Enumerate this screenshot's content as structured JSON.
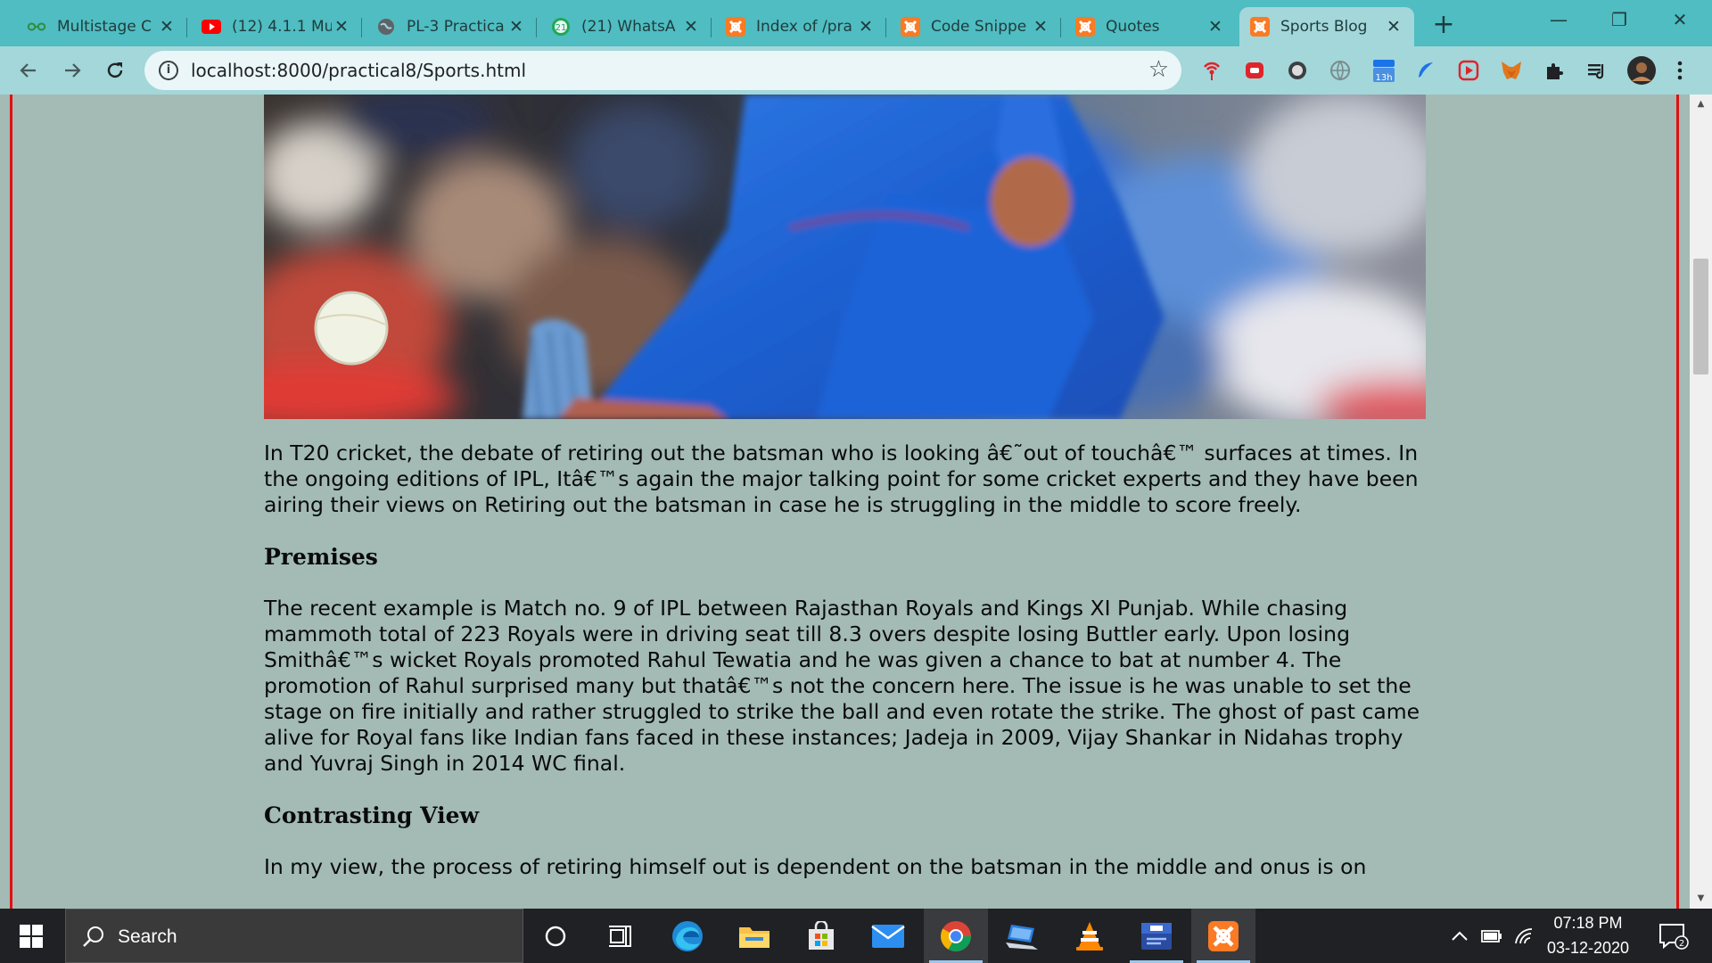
{
  "browser": {
    "tabs": [
      {
        "title": "Multistage C",
        "icon": "gfg-icon"
      },
      {
        "title": "(12) 4.1.1 Mu",
        "icon": "youtube-icon"
      },
      {
        "title": "PL-3 Practica",
        "icon": "globe-icon"
      },
      {
        "title": "(21) WhatsA",
        "icon": "whatsapp-icon"
      },
      {
        "title": "Index of /pra",
        "icon": "xampp-icon"
      },
      {
        "title": "Code Snippe",
        "icon": "xampp-icon"
      },
      {
        "title": "Quotes",
        "icon": "xampp-icon"
      },
      {
        "title": "Sports Blog",
        "icon": "xampp-icon",
        "active": true
      }
    ],
    "close_glyph": "✕",
    "new_tab_glyph": "+",
    "window_controls": {
      "minimize": "—",
      "restore": "❐",
      "close": "✕"
    },
    "url": "localhost:8000/practical8/Sports.html",
    "extension_badge": "13h",
    "accent_color": "#4fbdc1"
  },
  "page": {
    "background_color": "#a3bbb4",
    "border_color": "#e01010",
    "paragraphs": {
      "intro": "In T20 cricket, the debate of retiring out the batsman who is looking â€˜out of touchâ€™ surfaces at times. In the ongoing editions of IPL, Itâ€™s again the major talking point for some cricket experts and they have been airing their views on Retiring out the batsman in case he is struggling in the middle to score freely.",
      "premises_heading": "Premises",
      "premises": "The recent example is Match no. 9 of IPL between Rajasthan Royals and Kings XI Punjab. While chasing mammoth total of 223 Royals were in driving seat till 8.3 overs despite losing Buttler early. Upon losing Smithâ€™s wicket Royals promoted Rahul Tewatia and he was given a chance to bat at number 4. The promotion of Rahul surprised many but thatâ€™s not the concern here. The issue is he was unable to set the stage on fire initially and rather struggled to strike the ball and even rotate the strike. The ghost of past came alive for Royal fans like Indian fans faced in these instances; Jadeja in 2009, Vijay Shankar in Nidahas trophy and Yuvraj Singh in 2014 WC final.",
      "contrasting_heading": "Contrasting View",
      "contrasting": "In my view, the process of retiring himself out is dependent on the batsman in the middle and onus is on"
    }
  },
  "taskbar": {
    "search_label": "Search",
    "time": "07:18 PM",
    "date": "03-12-2020",
    "notification_count": "2"
  }
}
